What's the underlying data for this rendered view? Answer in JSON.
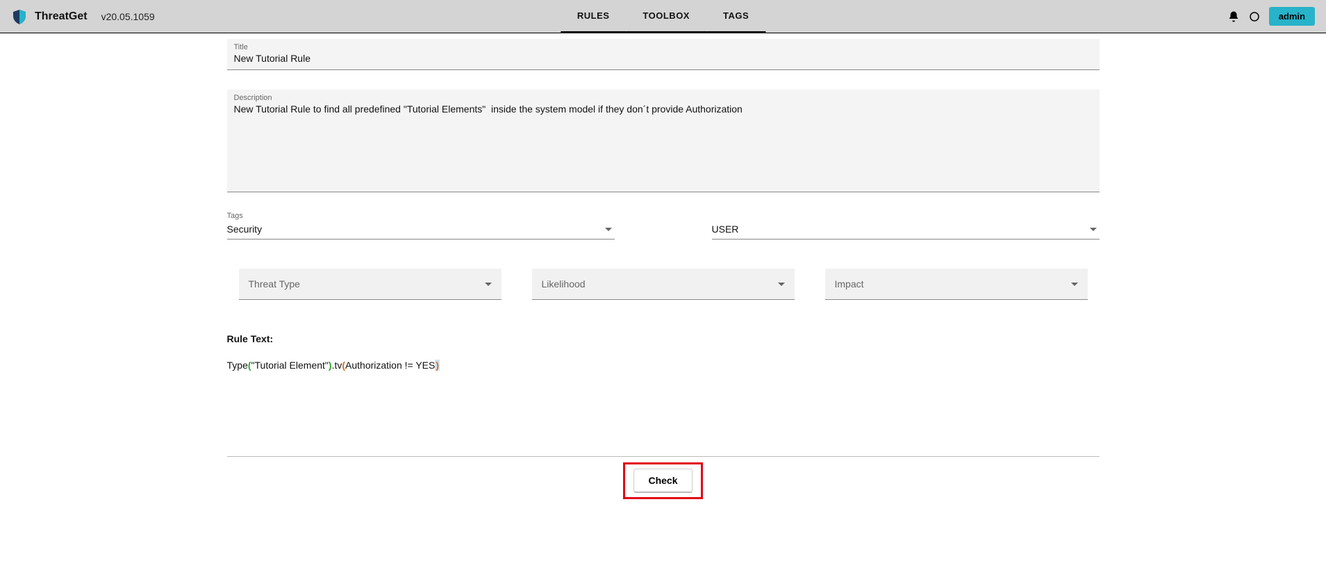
{
  "header": {
    "app_name": "ThreatGet",
    "version": "v20.05.1059",
    "nav": {
      "rules": "RULES",
      "toolbox": "TOOLBOX",
      "tags": "TAGS"
    },
    "user": "admin"
  },
  "form": {
    "title_label": "Title",
    "title_value": "New Tutorial Rule",
    "description_label": "Description",
    "description_value": "New Tutorial Rule to find all predefined \"Tutorial Elements\"  inside the system model if they don´t provide Authorization",
    "tags_label": "Tags",
    "tags_value": "Security",
    "user_select_value": "USER",
    "threat_type_placeholder": "Threat Type",
    "likelihood_placeholder": "Likelihood",
    "impact_placeholder": "Impact",
    "rule_text_label": "Rule Text:",
    "rule_tokens": {
      "t0": "Type",
      "t1": "(",
      "t2": "\"Tutorial Element\"",
      "t3": ")",
      "t4": ".tv",
      "t5": "(",
      "t6": "Authorization != YES",
      "t7": ")"
    },
    "check_button": "Check"
  }
}
